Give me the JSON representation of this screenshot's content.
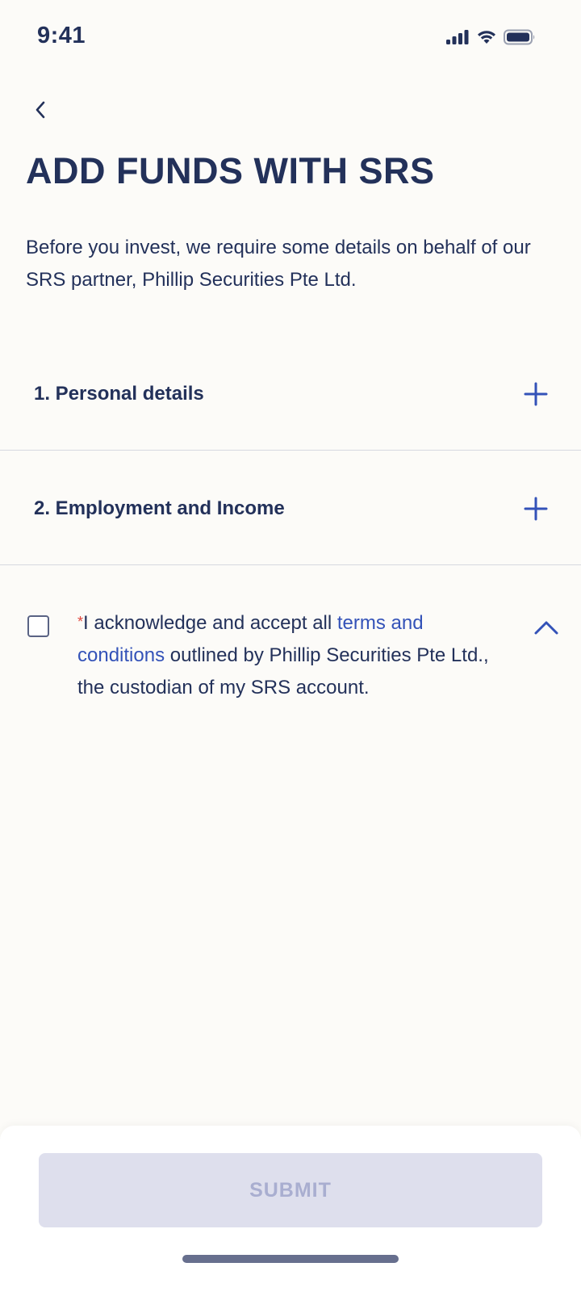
{
  "status_bar": {
    "time": "9:41",
    "icons": [
      "signal-icon",
      "wifi-icon",
      "battery-icon"
    ]
  },
  "header": {
    "back_icon": "chevron-left-icon",
    "title": "ADD FUNDS WITH SRS"
  },
  "intro_text": "Before you invest, we require some details on behalf of our SRS partner, Phillip Securities Pte Ltd.",
  "sections": [
    {
      "label": "1. Personal details",
      "icon": "plus-icon"
    },
    {
      "label": "2. Employment and Income",
      "icon": "plus-icon"
    }
  ],
  "terms": {
    "required_mark": "*",
    "text_before": "I acknowledge and accept all ",
    "link_text": "terms and conditions",
    "text_after": " outlined by Phillip Securities Pte Ltd., the custodian of my SRS account.",
    "checked": false,
    "icon": "chevron-up-icon"
  },
  "footer": {
    "submit_label": "SUBMIT",
    "submit_enabled": false
  },
  "colors": {
    "primary_text": "#23315a",
    "accent": "#3352b8",
    "required": "#e0463c",
    "background": "#fcfbf8",
    "button_disabled_bg": "#dedfed",
    "button_disabled_text": "#a9aed0"
  }
}
